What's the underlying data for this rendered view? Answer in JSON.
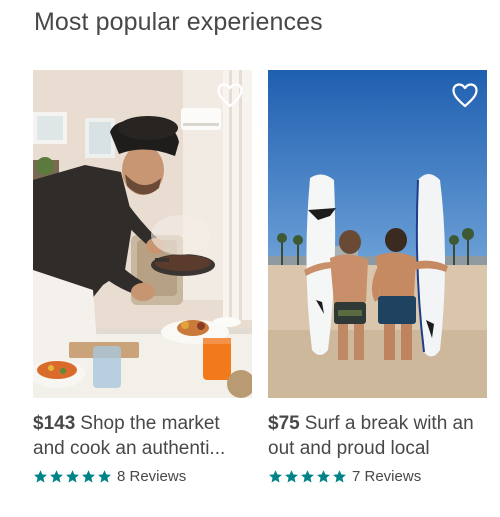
{
  "section": {
    "title": "Most popular experiences"
  },
  "experiences": [
    {
      "price": "$143",
      "title": "Shop the market and cook an authenti...",
      "rating_stars": 5,
      "reviews": "8 Reviews",
      "image": "chef-cooking-photo",
      "saved": false
    },
    {
      "price": "$75",
      "title": "Surf a break with an out and proud local",
      "rating_stars": 5,
      "reviews": "7 Reviews",
      "image": "surfers-beach-photo",
      "saved": false
    }
  ],
  "colors": {
    "star": "#008489",
    "text": "#484848",
    "heart_outline": "#ffffff"
  },
  "icons": {
    "save": "heart-outline-icon",
    "star": "star-icon"
  }
}
